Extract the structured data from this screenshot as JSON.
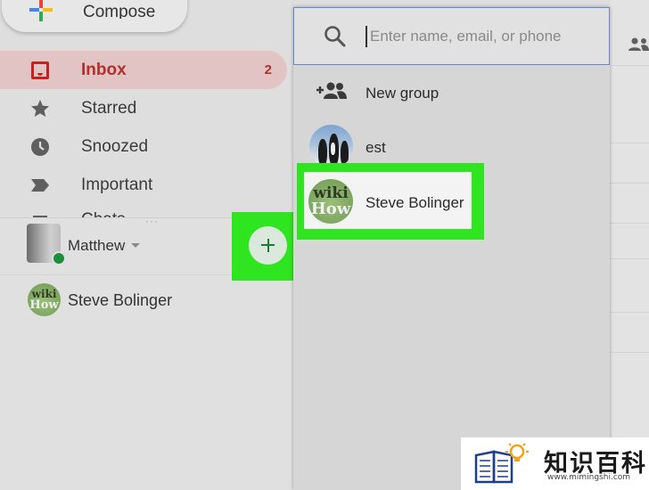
{
  "compose": {
    "label": "Compose"
  },
  "nav": [
    {
      "label": "Inbox",
      "count": "2",
      "icon": "inbox-icon",
      "active": true
    },
    {
      "label": "Starred",
      "icon": "star-icon"
    },
    {
      "label": "Snoozed",
      "icon": "clock-icon"
    },
    {
      "label": "Important",
      "icon": "important-icon"
    },
    {
      "label": "Chats",
      "icon": "chat-icon"
    }
  ],
  "hangouts": {
    "me_name": "Matthew",
    "contact_name": "Steve Bolinger"
  },
  "popup": {
    "search_placeholder": "Enter name, email, or phone",
    "new_group_label": "New group",
    "results": [
      {
        "name": "est",
        "avatar": "penguins-avatar"
      },
      {
        "name": "Steve Bolinger",
        "avatar": "wikihow-avatar"
      }
    ]
  },
  "avatar_text": {
    "line1": "wiki",
    "line2": "How"
  },
  "watermark": {
    "title": "知识百科",
    "url": "www.mimingshi.com"
  },
  "colors": {
    "highlight": "#2ee51f",
    "inbox_active": "#b2302b",
    "online": "#1e8e3e"
  }
}
